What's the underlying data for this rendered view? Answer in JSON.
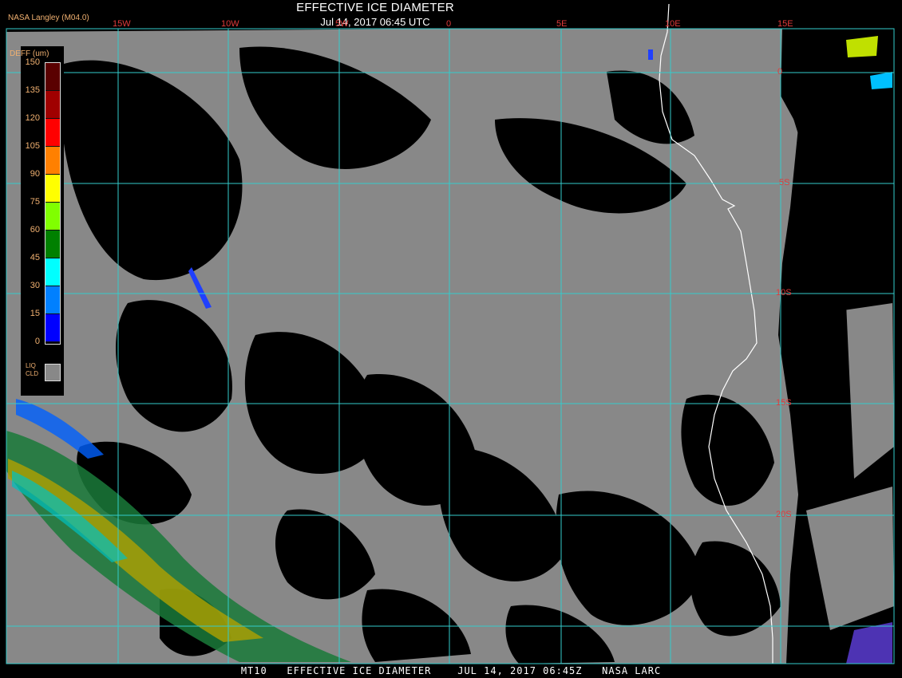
{
  "header": {
    "title": "EFFECTIVE ICE DIAMETER",
    "subtitle": "Jul 14, 2017 06:45 UTC",
    "credit": "NASA Langley (M04.0)"
  },
  "longitudes": [
    "15W",
    "10W",
    "5W",
    "0",
    "5E",
    "10E",
    "15E"
  ],
  "latitudes": [
    "0",
    "5S",
    "10S",
    "15S",
    "20S"
  ],
  "legend": {
    "title": "DEFF (um)",
    "ticks": [
      "150",
      "135",
      "120",
      "105",
      "90",
      "75",
      "60",
      "45",
      "30",
      "15",
      "0"
    ],
    "colors": [
      "#5a0000",
      "#a00000",
      "#ff0000",
      "#ff8000",
      "#ffff00",
      "#80ff00",
      "#008000",
      "#00ffff",
      "#0080ff",
      "#0000ff",
      "#8040e0"
    ],
    "liq_label": "LIQ\nCLD",
    "liq_color": "#888888"
  },
  "footer": "MT10   EFFECTIVE ICE DIAMETER    JUL 14, 2017 06:45Z   NASA LARC",
  "colors": {
    "cloud": "#888888",
    "grid": "#33cccc",
    "coast": "#ffffff",
    "label": "#e23a3a"
  }
}
